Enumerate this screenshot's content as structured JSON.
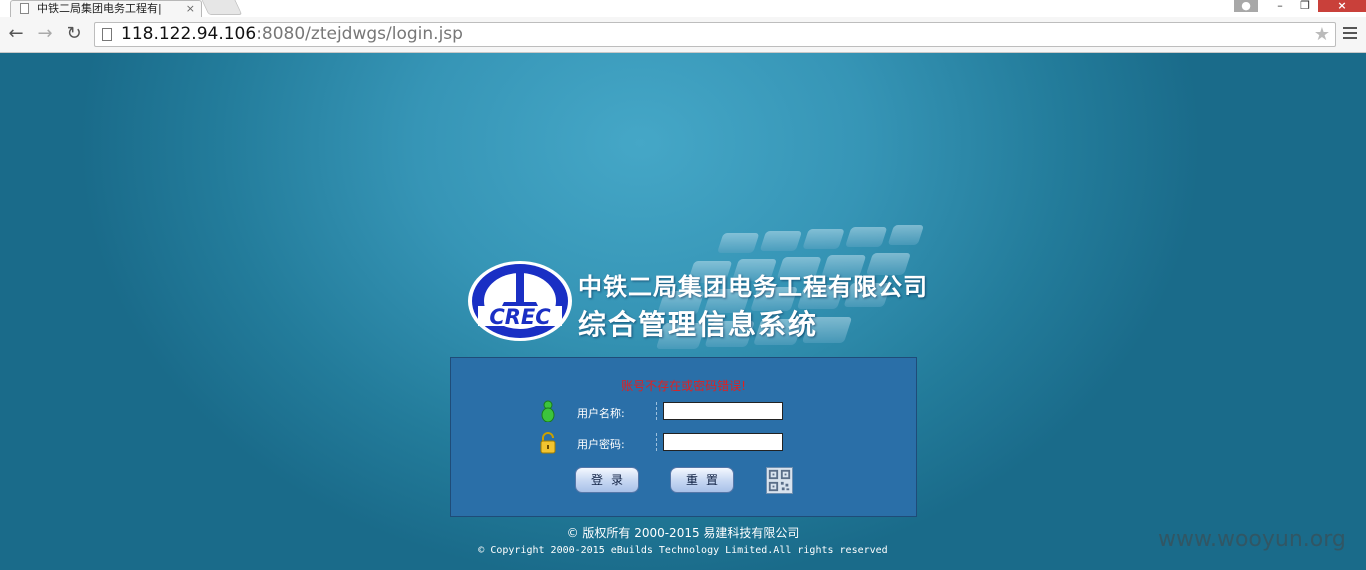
{
  "browser": {
    "tab_title": "中铁二局集团电务工程有|",
    "url_host": "118.122.94.106",
    "url_rest": ":8080/ztejdwgs/login.jsp"
  },
  "logo": {
    "emblem_text": "CREC"
  },
  "header": {
    "company_name": "中铁二局集团电务工程有限公司",
    "system_name": "综合管理信息系统"
  },
  "login": {
    "error_message": "账号不存在或密码错误!",
    "username_label": "用户名称:",
    "password_label": "用户密码:",
    "username_value": "",
    "password_value": "",
    "login_button": "登录",
    "reset_button": "重置"
  },
  "footer": {
    "copyright_cn": "© 版权所有 2000-2015 易建科技有限公司",
    "copyright_en": "© Copyright 2000-2015 eBuilds Technology Limited.All rights reserved"
  },
  "watermark": "www.wooyun.org",
  "colors": {
    "panel_bg": "#2a6fa8",
    "error_text": "#e02020",
    "emblem_blue": "#1a2fc4"
  }
}
